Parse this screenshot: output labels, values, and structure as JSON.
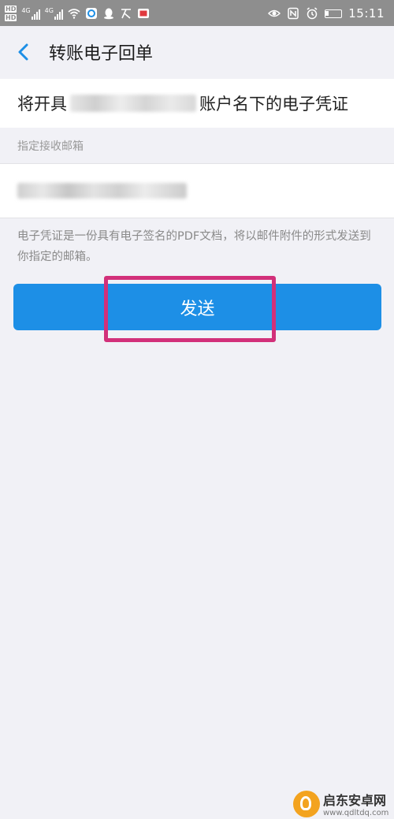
{
  "status_bar": {
    "net1": "4G",
    "net2": "4G",
    "time": "15:11"
  },
  "nav": {
    "title": "转账电子回单"
  },
  "account": {
    "prefix": "将开具",
    "suffix": "账户名下的电子凭证"
  },
  "email": {
    "section_label": "指定接收邮箱"
  },
  "note": {
    "text": "电子凭证是一份具有电子签名的PDF文档，将以邮件附件的形式发送到你指定的邮箱。"
  },
  "send_button": {
    "label": "发送"
  },
  "colors": {
    "accent": "#1d8fe6",
    "highlight": "#d2307a",
    "background": "#f1f1f6"
  },
  "watermark": {
    "name": "启东安卓网",
    "url": "www.qdltdq.com"
  }
}
